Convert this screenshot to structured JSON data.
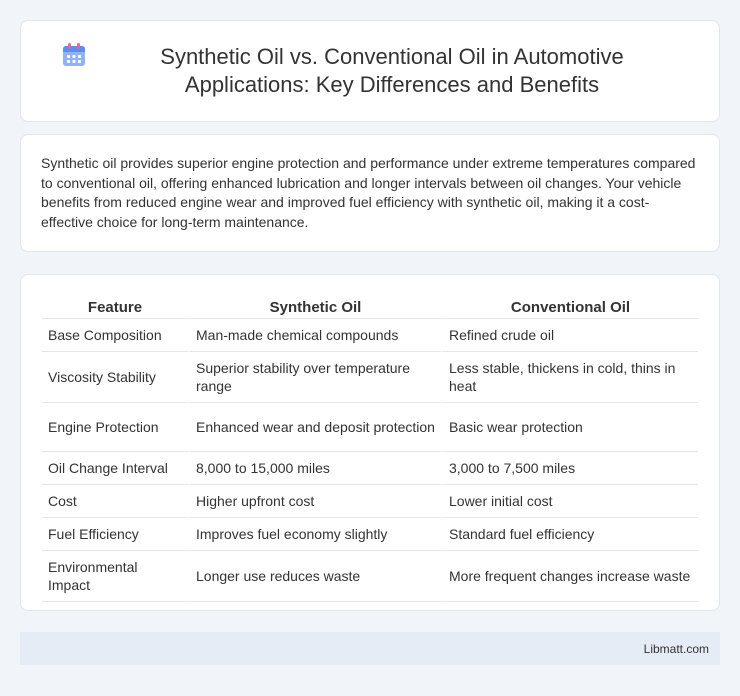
{
  "header": {
    "icon": "calendar-icon",
    "title": "Synthetic Oil vs. Conventional Oil in Automotive Applications: Key Differences and Benefits"
  },
  "intro": {
    "text": "Synthetic oil provides superior engine protection and performance under extreme temperatures compared to conventional oil, offering enhanced lubrication and longer intervals between oil changes. Your vehicle benefits from reduced engine wear and improved fuel efficiency with synthetic oil, making it a cost-effective choice for long-term maintenance."
  },
  "table": {
    "headers": [
      "Feature",
      "Synthetic Oil",
      "Conventional Oil"
    ],
    "rows": [
      [
        "Base Composition",
        "Man-made chemical compounds",
        "Refined crude oil"
      ],
      [
        "Viscosity Stability",
        "Superior stability over temperature range",
        "Less stable, thickens in cold, thins in heat"
      ],
      [
        "Engine Protection",
        "Enhanced wear and deposit protection",
        "Basic wear protection"
      ],
      [
        "Oil Change Interval",
        "8,000 to 15,000 miles",
        "3,000 to 7,500 miles"
      ],
      [
        "Cost",
        "Higher upfront cost",
        "Lower initial cost"
      ],
      [
        "Fuel Efficiency",
        "Improves fuel economy slightly",
        "Standard fuel efficiency"
      ],
      [
        "Environmental Impact",
        "Longer use reduces waste",
        "More frequent changes increase waste"
      ]
    ]
  },
  "footer": {
    "site": "Libmatt.com"
  },
  "colors": {
    "background": "#f1f4f9",
    "card": "#ffffff",
    "footer": "#e6ecf6",
    "icon_blue": "#5b8def",
    "icon_pink": "#e86a8c"
  }
}
